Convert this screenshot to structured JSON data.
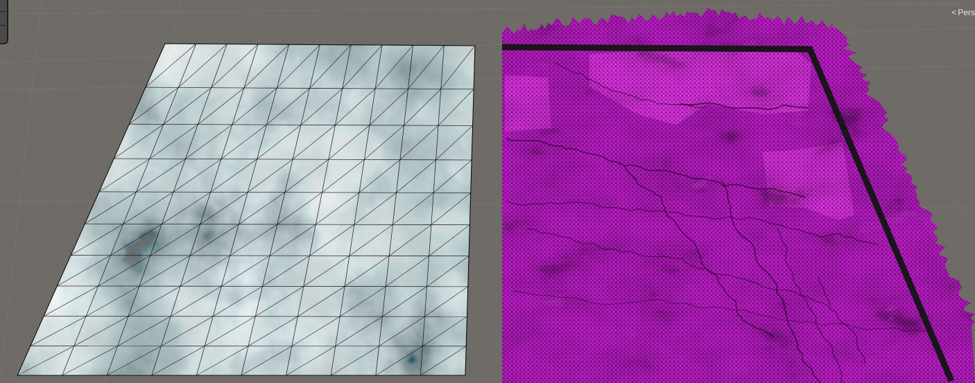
{
  "scene_view": {
    "background_color": "#6f6b66",
    "projection_toggle": {
      "icon": "perspective-icon",
      "icon_glyph": "<",
      "label": "Pers"
    },
    "objects": [
      {
        "name": "noise-textured-plane",
        "render_mode": "shaded-wireframe",
        "texture": "cloud-noise-greyscale",
        "grid": {
          "columns": 10,
          "rows": 10
        },
        "colors": {
          "light": "#c4d6d8",
          "mid": "#8fa6aa",
          "dark": "#1f2b2d",
          "wire": "#0c0c0c"
        }
      },
      {
        "name": "heightmap-terrain-mesh",
        "render_mode": "wireframe",
        "material": "missing-material-magenta",
        "colors": {
          "base": "#c41fd0",
          "bright": "#f036f3",
          "wire": "#1a001c",
          "border": "#1c141c"
        }
      }
    ]
  }
}
